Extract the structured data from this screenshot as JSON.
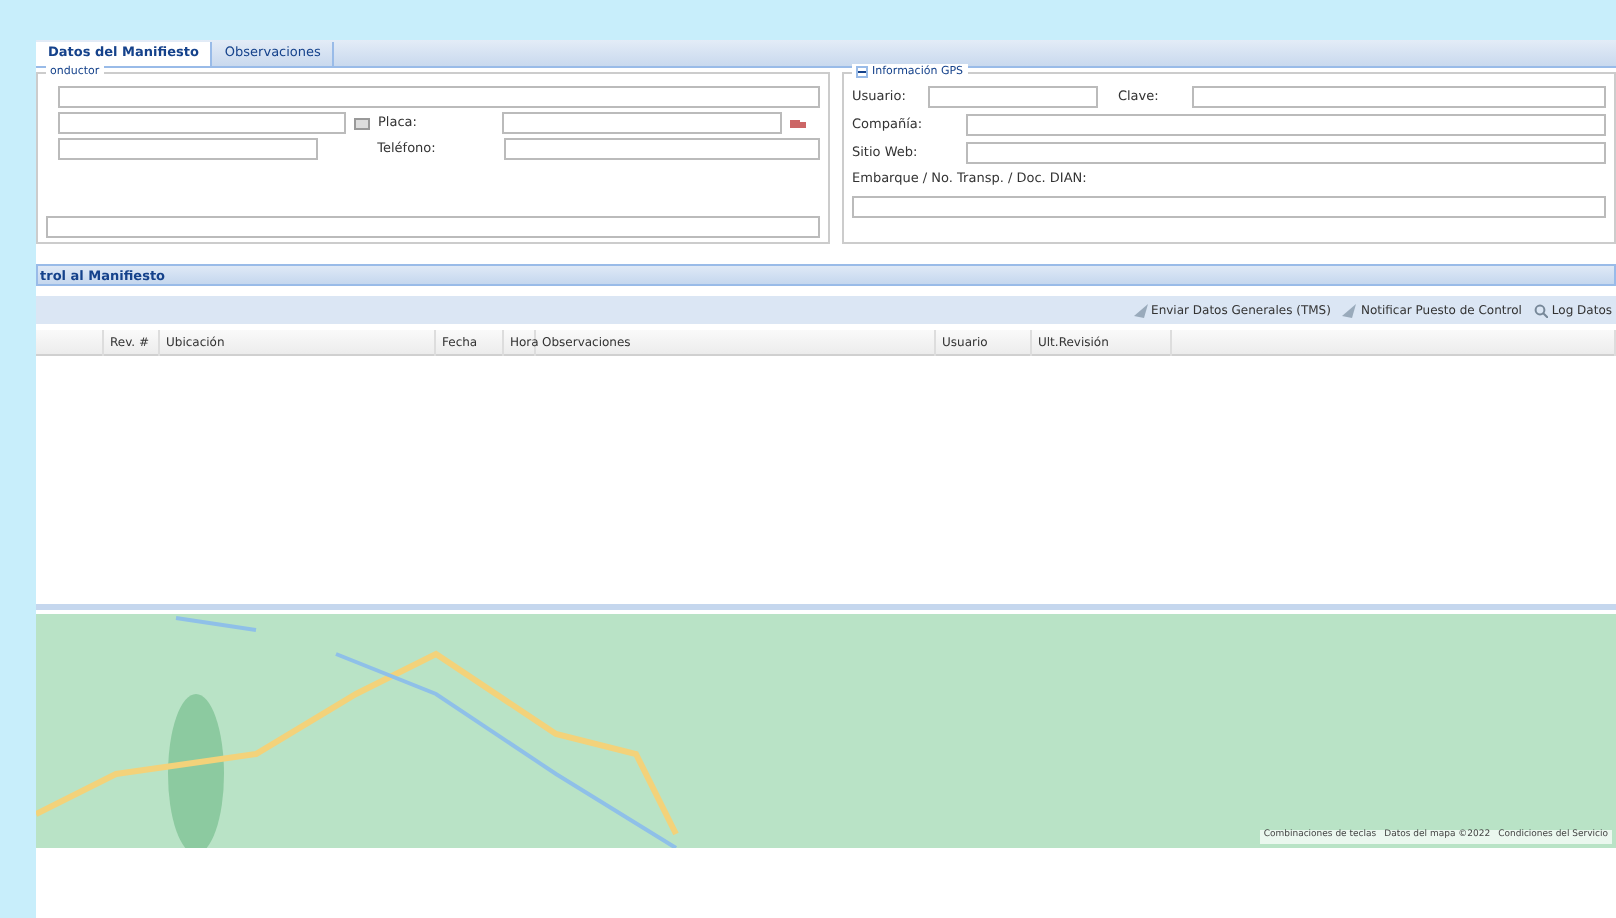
{
  "tabs": [
    {
      "label": "Datos del Manifiesto",
      "selected": true
    },
    {
      "label": "Observaciones",
      "selected": false
    }
  ],
  "conductor": {
    "legend": "onductor",
    "placa_label": "Placa:",
    "telefono_label": "Teléfono:"
  },
  "gps": {
    "legend": "Información GPS",
    "expanded": true,
    "usuario_label": "Usuario:",
    "clave_label": "Clave:",
    "compania_label": "Compañía:",
    "sitio_label": "Sitio Web:",
    "embarque_label": "Embarque / No. Transp. / Doc. DIAN:"
  },
  "panel": {
    "title": "trol al Manifiesto"
  },
  "toolbar": [
    "Enviar Datos Generales (TMS)",
    "Notificar Puesto de Control",
    "Log Datos"
  ],
  "table": {
    "columns": [
      "",
      "Rev. #",
      "Ubicación",
      "Fecha",
      "Hora",
      "Observaciones",
      "Usuario",
      "Ult.Revisión"
    ]
  },
  "map": {
    "attribution": [
      "Combinaciones de teclas",
      "Datos del mapa ©2022",
      "Condiciones del Servicio"
    ]
  }
}
